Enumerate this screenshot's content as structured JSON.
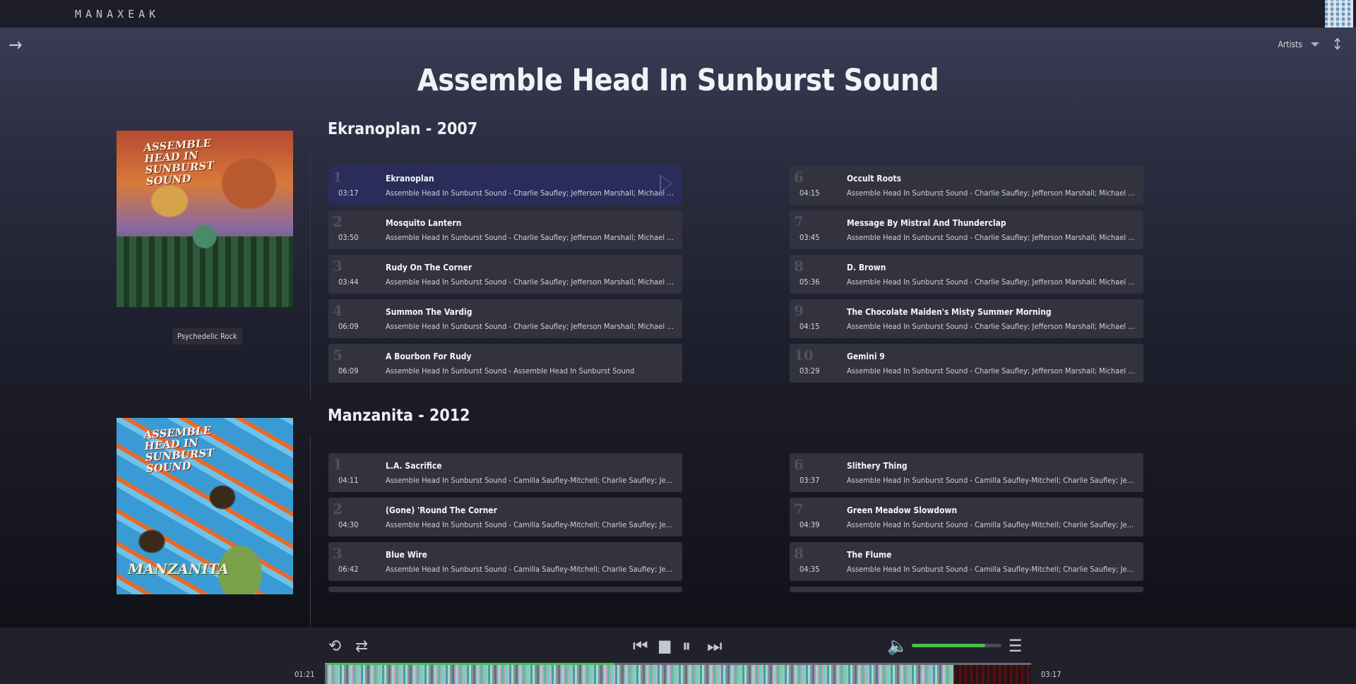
{
  "app": {
    "logo_text": "MANAXEAK"
  },
  "header": {
    "sort_label": "Artists"
  },
  "artist": {
    "name": "Assemble Head In Sunburst Sound"
  },
  "albums": [
    {
      "heading": "Ekranoplan - 2007",
      "genre": "Psychedelic Rock",
      "cover_lettering": "ASSEMBLE HEAD IN SUNBURST SOUND",
      "tracks_left": [
        {
          "num": "1",
          "title": "Ekranoplan",
          "duration": "03:17",
          "artists": "Assemble Head In Sunburst Sound - Charlie Saufley; Jefferson Marshall; Michael Lardas"
        },
        {
          "num": "2",
          "title": "Mosquito Lantern",
          "duration": "03:50",
          "artists": "Assemble Head In Sunburst Sound - Charlie Saufley; Jefferson Marshall; Michael Lardas"
        },
        {
          "num": "3",
          "title": "Rudy On The Corner",
          "duration": "03:44",
          "artists": "Assemble Head In Sunburst Sound - Charlie Saufley; Jefferson Marshall; Michael Lardas"
        },
        {
          "num": "4",
          "title": "Summon The Vardig",
          "duration": "06:09",
          "artists": "Assemble Head In Sunburst Sound - Charlie Saufley; Jefferson Marshall; Michael Lardas"
        },
        {
          "num": "5",
          "title": "A Bourbon For Rudy",
          "duration": "06:09",
          "artists": "Assemble Head In Sunburst Sound - Assemble Head In Sunburst Sound"
        }
      ],
      "tracks_right": [
        {
          "num": "6",
          "title": "Occult Roots",
          "duration": "04:15",
          "artists": "Assemble Head In Sunburst Sound - Charlie Saufley; Jefferson Marshall; Michael Lardas"
        },
        {
          "num": "7",
          "title": "Message By Mistral And Thunderclap",
          "duration": "03:45",
          "artists": "Assemble Head In Sunburst Sound - Charlie Saufley; Jefferson Marshall; Michael Lardas"
        },
        {
          "num": "8",
          "title": "D. Brown",
          "duration": "05:36",
          "artists": "Assemble Head In Sunburst Sound - Charlie Saufley; Jefferson Marshall; Michael Lardas"
        },
        {
          "num": "9",
          "title": "The Chocolate Maiden's Misty Summer Morning",
          "duration": "04:15",
          "artists": "Assemble Head In Sunburst Sound - Charlie Saufley; Jefferson Marshall; Michael Lardas"
        },
        {
          "num": "10",
          "title": "Gemini 9",
          "duration": "03:29",
          "artists": "Assemble Head In Sunburst Sound - Charlie Saufley; Jefferson Marshall; Michael Lardas"
        }
      ]
    },
    {
      "heading": "Manzanita - 2012",
      "cover_lettering": "ASSEMBLE HEAD IN SUNBURST SOUND",
      "cover_lettering_2": "MANZANITA",
      "tracks_left": [
        {
          "num": "1",
          "title": "L.A. Sacrifice",
          "duration": "04:11",
          "artists": "Assemble Head In Sunburst Sound - Camilla Saufley-Mitchell; Charlie Saufley; Jefferson Marshall; Michael Lardas"
        },
        {
          "num": "2",
          "title": "(Gone) 'Round The Corner",
          "duration": "04:30",
          "artists": "Assemble Head In Sunburst Sound - Camilla Saufley-Mitchell; Charlie Saufley; Jefferson Marshall; Michael Lardas"
        },
        {
          "num": "3",
          "title": "Blue Wire",
          "duration": "06:42",
          "artists": "Assemble Head In Sunburst Sound - Camilla Saufley-Mitchell; Charlie Saufley; Jefferson Marshall; Michael Lardas"
        }
      ],
      "tracks_right": [
        {
          "num": "6",
          "title": "Slithery Thing",
          "duration": "03:37",
          "artists": "Assemble Head In Sunburst Sound - Camilla Saufley-Mitchell; Charlie Saufley; Jefferson Marshall; Michael Lardas"
        },
        {
          "num": "7",
          "title": "Green Meadow Slowdown",
          "duration": "04:39",
          "artists": "Assemble Head In Sunburst Sound - Camilla Saufley-Mitchell; Charlie Saufley; Jefferson Marshall; Michael Lardas"
        },
        {
          "num": "8",
          "title": "The Flume",
          "duration": "04:35",
          "artists": "Assemble Head In Sunburst Sound - Camilla Saufley-Mitchell; Charlie Saufley; Jefferson Marshall; Michael Lardas"
        }
      ]
    }
  ],
  "player": {
    "elapsed": "01:21",
    "total": "03:17",
    "progress_fraction": 0.41,
    "volume_fraction": 0.82,
    "accent_color": "#46c04f",
    "icons": [
      "repeat-icon",
      "shuffle-icon",
      "previous-icon",
      "stop-icon",
      "pause-icon",
      "next-icon",
      "volume-icon",
      "queue-icon"
    ]
  }
}
